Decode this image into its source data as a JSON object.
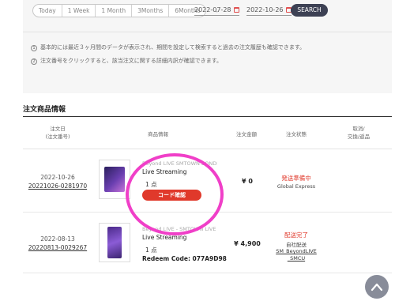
{
  "filter": {
    "periods": [
      "Today",
      "1 Week",
      "1 Month",
      "3Months",
      "6Months"
    ],
    "date_from": "2022-07-28",
    "date_to": "2022-10-26",
    "date_separator": "-",
    "search_label": "SEARCH",
    "notes": [
      {
        "num": "1",
        "text": "基本的には最近３ヶ月間のデータが表示され、期間を設定して検索すると過去の注文履歴も確認できます。"
      },
      {
        "num": "2",
        "text": "注文番号をクリックすると、該当注文に関する詳細内訳が確認できます。"
      }
    ]
  },
  "section_title": "注文商品情報",
  "columns": {
    "date_line1": "注文日",
    "date_line2": "(注文番号)",
    "product": "商品情報",
    "amount": "注文金額",
    "status": "注文状態",
    "cancel_line1": "取消/",
    "cancel_line2": "交換/返品"
  },
  "orders": [
    {
      "date": "2022-10-26",
      "order_no": "20221026-0281970",
      "product_faded": "Beyond LIVE SMTOWN BONDE",
      "product_name": "Live Streaming",
      "qty": "1 点",
      "action": "コード確認",
      "price": "¥ 0",
      "status": "発送準備中",
      "status_sub": "Global Express"
    },
    {
      "date": "2022-08-13",
      "order_no": "20220813-0029267",
      "product_faded": "Beyond LIVE - SMTOWN LIVE 20",
      "product_name": "Live Streaming",
      "qty": "1 点",
      "redeem": "Redeem Code: 077A9D98",
      "price": "¥ 4,900",
      "status": "配送完了",
      "status_sub": "自社配送",
      "status_link_line1": "SM_BeyondLIVE",
      "status_link_line2": "_SMCU"
    }
  ],
  "colors": {
    "accent_red": "#e0392b",
    "highlight": "#f03fc8",
    "search_bg": "#3d4154"
  },
  "icons": {
    "calendar": "calendar-icon",
    "scroll_top": "chevron-up-icon"
  }
}
